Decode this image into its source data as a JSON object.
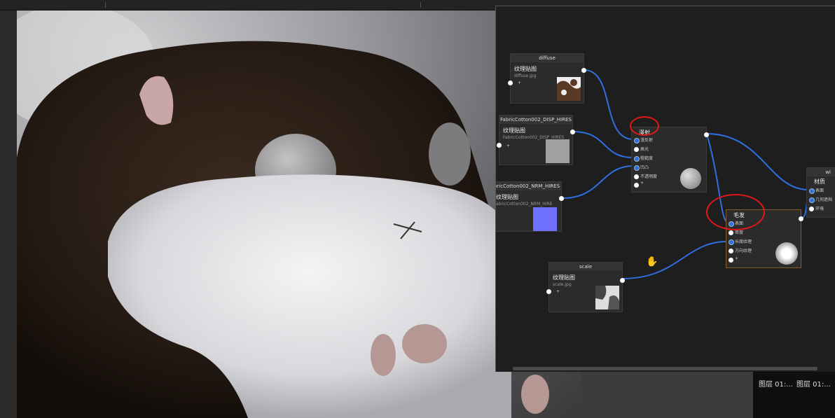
{
  "node_editor": {
    "nodes": {
      "diffuse": {
        "header": "diffuse",
        "title": "纹理贴图",
        "file": "diffuse.jpg",
        "extra": "+"
      },
      "disp": {
        "header": "FabricCotton002_DISP_HIRES",
        "title": "纹理贴图",
        "file": "FabricCotton002_DISP_HIRES",
        "extra": "+"
      },
      "nrm": {
        "header": "bricCotton002_NRM_HIRES",
        "title": "纹理贴图",
        "file": "abricCotton002_NRM_HIRE",
        "extra": "+"
      },
      "scale": {
        "header": "scale",
        "title": "纹理贴图",
        "file": "scale.jpg",
        "extra": "+"
      },
      "material": {
        "title": "漫射",
        "inputs": [
          "漫反射",
          "高光",
          "粗糙度",
          "凹凸",
          "不透明度",
          "+"
        ]
      },
      "fur": {
        "title": "毛发",
        "inputs": [
          "表面",
          "密度",
          "长度纹理",
          "方向纹理",
          "+"
        ]
      },
      "output": {
        "header": "wi",
        "title": "材质",
        "inputs": [
          "表面",
          "几何遮挡",
          "环境"
        ]
      }
    }
  },
  "layers_panel": {
    "items": [
      "图层 01:...",
      "图层 01:..."
    ]
  },
  "colors": {
    "wire": "#2f6fe0",
    "annotation": "#e01818",
    "nrm_swatch": "#7070ff",
    "disp_swatch": "#a0a0a0"
  }
}
